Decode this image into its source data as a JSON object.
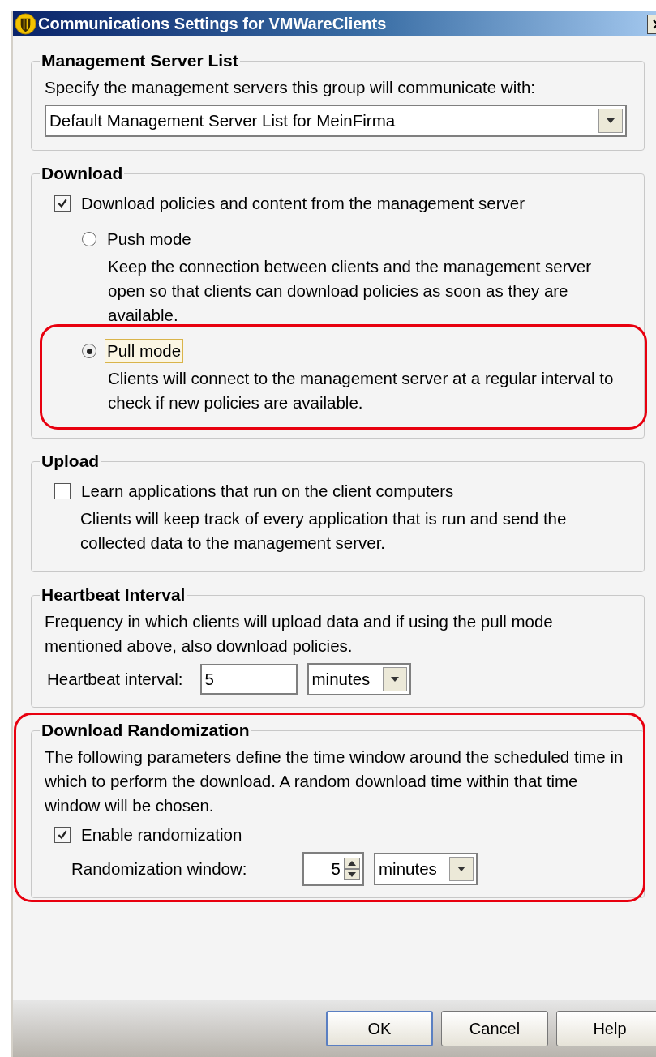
{
  "window": {
    "title": "Communications Settings for VMWareClients"
  },
  "sections": [
    {
      "title": "Management Server List",
      "highlighted": false,
      "items": [
        {
          "kind": "text",
          "text": "Specify the management servers this group will communicate with:"
        },
        {
          "kind": "dropdown",
          "value": "Default Management Server List for MeinFirma"
        }
      ]
    },
    {
      "title": "Download",
      "highlighted": false,
      "items": [
        {
          "kind": "checkbox",
          "label": "Download policies and content from the management server",
          "checked": true
        },
        {
          "kind": "radio",
          "label": "Push mode",
          "selected": false,
          "focused": false,
          "highlighted": false,
          "description": "Keep the connection between clients and the management server open so that clients can download policies as soon as they are available."
        },
        {
          "kind": "radio",
          "label": "Pull mode",
          "selected": true,
          "focused": true,
          "highlighted": true,
          "description": "Clients will connect to the management server at a regular interval to check if new policies are available."
        }
      ]
    },
    {
      "title": "Upload",
      "highlighted": false,
      "items": [
        {
          "kind": "checkbox",
          "label": "Learn applications that run on the client computers",
          "checked": false,
          "description": "Clients will keep track of every application that is run and send the collected data to the management server."
        }
      ]
    },
    {
      "title": "Heartbeat Interval",
      "highlighted": false,
      "items": [
        {
          "kind": "text",
          "text": "Frequency in which clients will upload data and if using the pull mode mentioned above, also download policies."
        },
        {
          "kind": "interval",
          "label": "Heartbeat interval:",
          "value": "5",
          "unit": "minutes"
        }
      ]
    },
    {
      "title": "Download Randomization",
      "highlighted": true,
      "items": [
        {
          "kind": "text",
          "text": "The following parameters define the time window around the scheduled time in which to perform the download. A random download time within that time window will be chosen."
        },
        {
          "kind": "checkbox",
          "label": "Enable randomization",
          "checked": true
        },
        {
          "kind": "spinner",
          "label": "Randomization window:",
          "value": "5",
          "unit": "minutes"
        }
      ]
    }
  ],
  "buttons": [
    {
      "label": "OK",
      "default": true
    },
    {
      "label": "Cancel",
      "default": false
    },
    {
      "label": "Help",
      "default": false
    }
  ]
}
